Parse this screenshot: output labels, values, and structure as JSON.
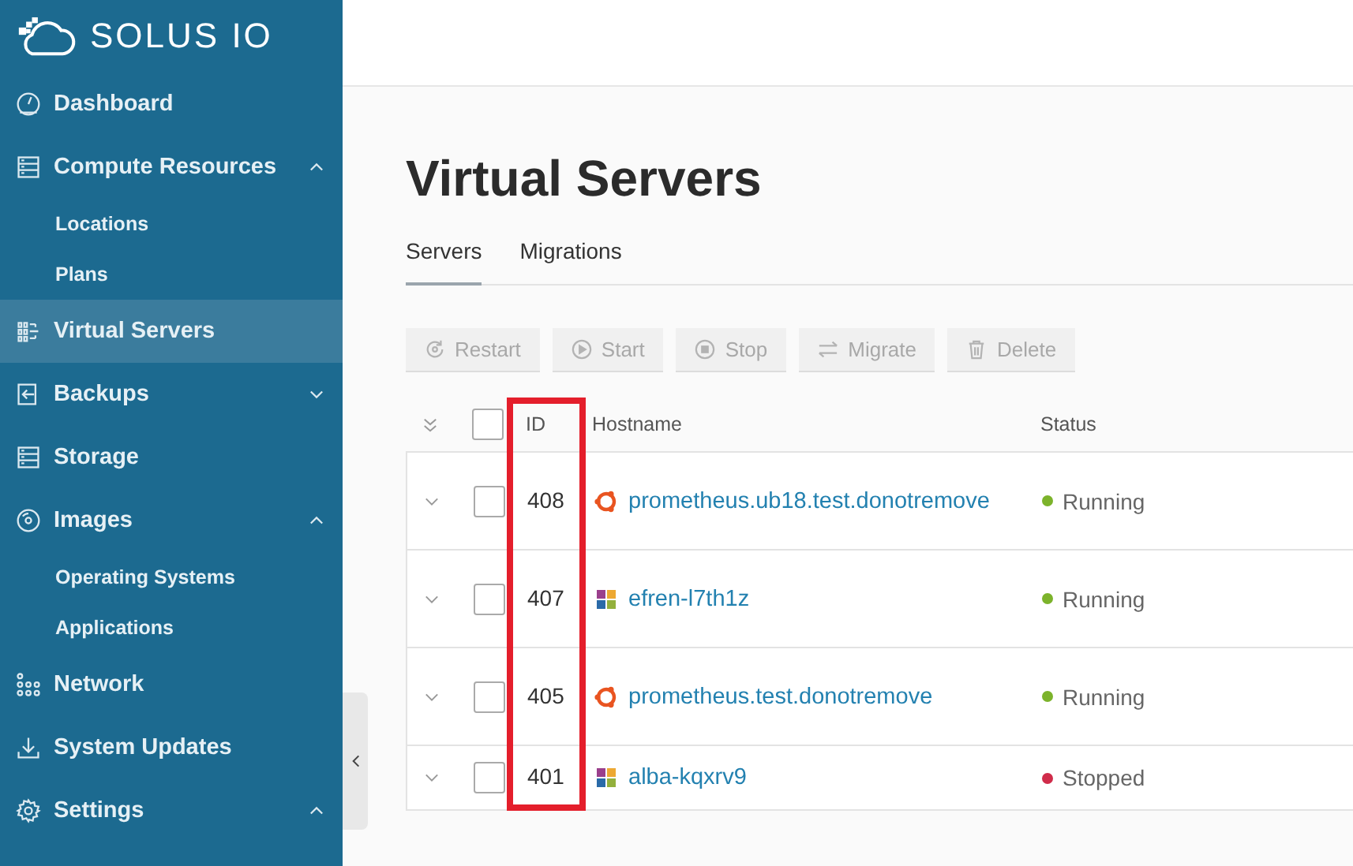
{
  "logo": {
    "text": "SOLUS IO"
  },
  "sidebar": {
    "items": [
      {
        "label": "Dashboard",
        "selected": false
      },
      {
        "label": "Compute Resources",
        "selected": false,
        "expanded": true,
        "children": [
          {
            "label": "Locations",
            "selected": false
          },
          {
            "label": "Plans",
            "selected": false
          }
        ]
      },
      {
        "label": "Virtual Servers",
        "selected": true
      },
      {
        "label": "Backups",
        "selected": false,
        "expanded": false
      },
      {
        "label": "Storage",
        "selected": false
      },
      {
        "label": "Images",
        "selected": false,
        "expanded": true,
        "children": [
          {
            "label": "Operating Systems",
            "selected": false
          },
          {
            "label": "Applications",
            "selected": false
          }
        ]
      },
      {
        "label": "Network",
        "selected": false
      },
      {
        "label": "System Updates",
        "selected": false
      },
      {
        "label": "Settings",
        "selected": false,
        "expanded": true
      }
    ]
  },
  "page": {
    "title": "Virtual Servers"
  },
  "tabs": [
    {
      "label": "Servers",
      "selected": true
    },
    {
      "label": "Migrations",
      "selected": false
    }
  ],
  "toolbar": [
    {
      "label": "Restart",
      "disabled": true
    },
    {
      "label": "Start",
      "disabled": true
    },
    {
      "label": "Stop",
      "disabled": true
    },
    {
      "label": "Migrate",
      "disabled": true
    },
    {
      "label": "Delete",
      "disabled": true
    }
  ],
  "table": {
    "columns": [
      "ID",
      "Hostname",
      "Status"
    ],
    "header_checked": false,
    "rows": [
      {
        "id": "408",
        "hostname": "prometheus.ub18.test.donotremove",
        "kind": "ubuntu",
        "status": "Running",
        "color": "#7cb32b",
        "checked": false,
        "expanded": false
      },
      {
        "id": "407",
        "hostname": "efren-l7th1z",
        "kind": "flower",
        "status": "Running",
        "color": "#7cb32b",
        "checked": false,
        "expanded": false
      },
      {
        "id": "405",
        "hostname": "prometheus.test.donotremove",
        "kind": "ubuntu",
        "status": "Running",
        "color": "#7cb32b",
        "checked": false,
        "expanded": false
      },
      {
        "id": "401",
        "hostname": "alba-kqxrv9",
        "kind": "flower",
        "status": "Stopped",
        "color": "#d02c4a",
        "checked": false,
        "expanded": false
      }
    ]
  }
}
